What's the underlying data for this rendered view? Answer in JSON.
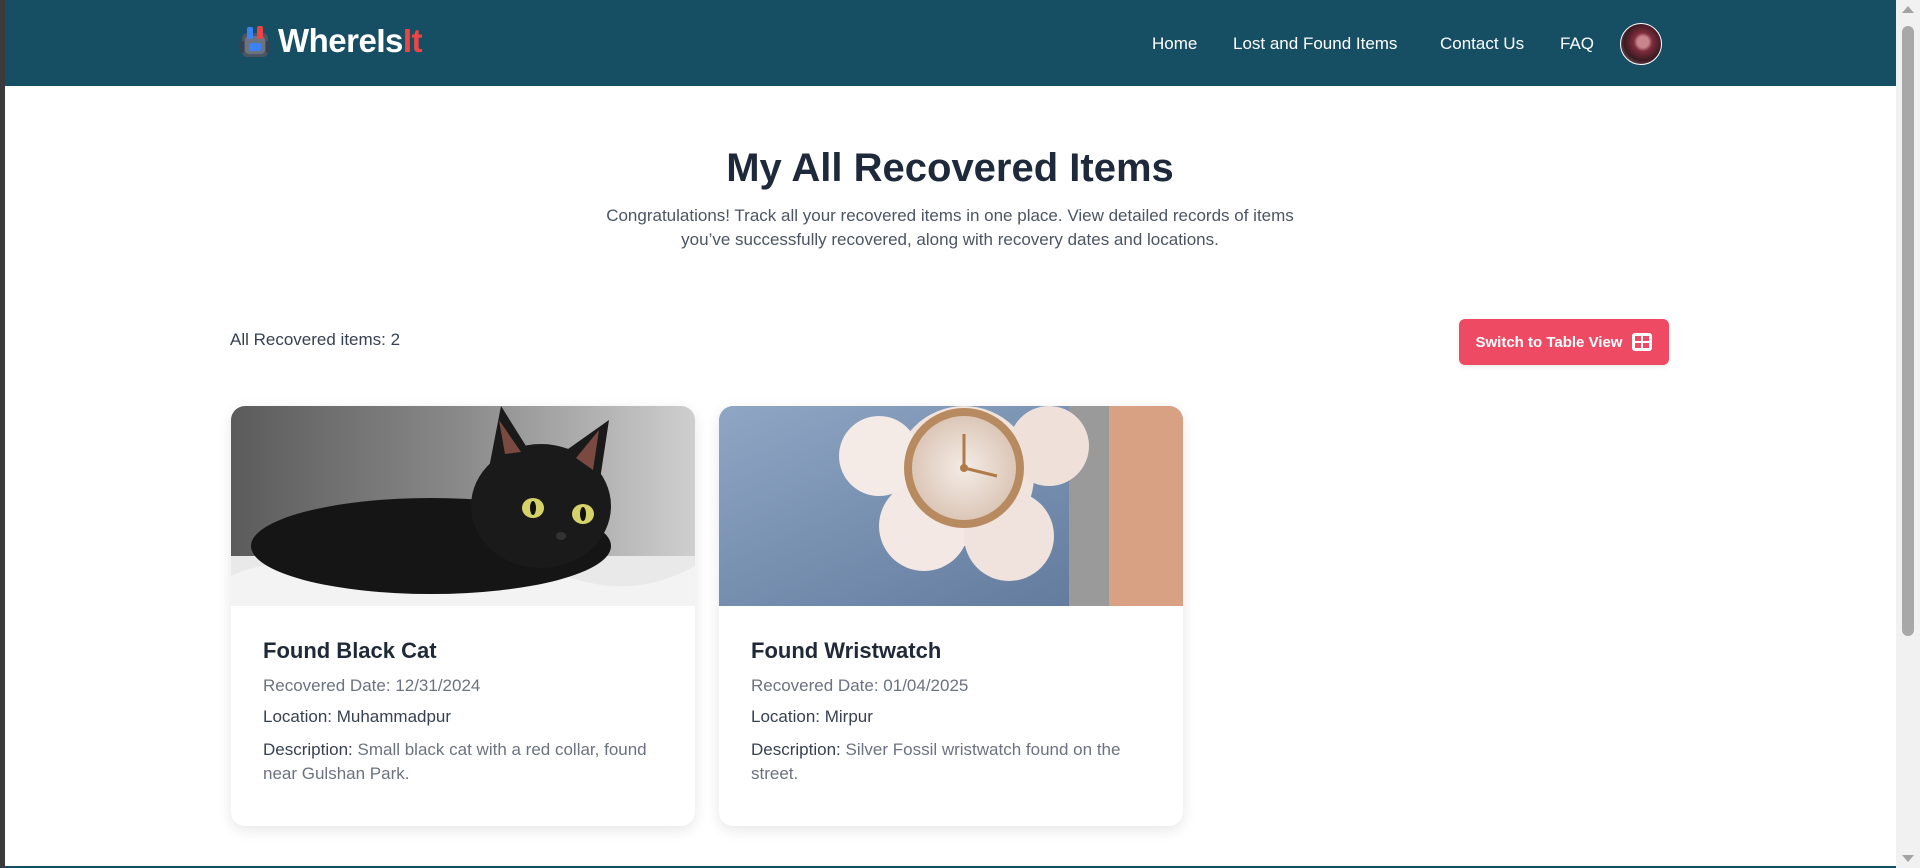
{
  "nav": {
    "brand_main": "WhereIs",
    "brand_accent": "It",
    "links": [
      "Home",
      "Lost and Found Items",
      "Contact Us",
      "FAQ"
    ]
  },
  "page": {
    "title": "My All Recovered Items",
    "subtitle": "Congratulations! Track all your recovered items in one place. View detailed records of items you’ve successfully recovered, along with recovery dates and locations."
  },
  "summary": {
    "count_text": "All Recovered items: 2",
    "switch_label": "Switch to Table View"
  },
  "cards": [
    {
      "title": "Found Black Cat",
      "date": "Recovered Date: 12/31/2024",
      "location": "Location: Muhammadpur",
      "desc_label": "Description:",
      "desc_text": "Small black cat with a red collar, found near Gulshan Park.",
      "image_icon": "black-cat-photo"
    },
    {
      "title": "Found Wristwatch",
      "date": "Recovered Date: 01/04/2025",
      "location": "Location: Mirpur",
      "desc_label": "Description:",
      "desc_text": "Silver Fossil wristwatch found on the street.",
      "image_icon": "wristwatch-photo"
    }
  ],
  "colors": {
    "navbar": "#164e63",
    "accent": "#ef4a63",
    "brand_accent": "#ef4444"
  }
}
